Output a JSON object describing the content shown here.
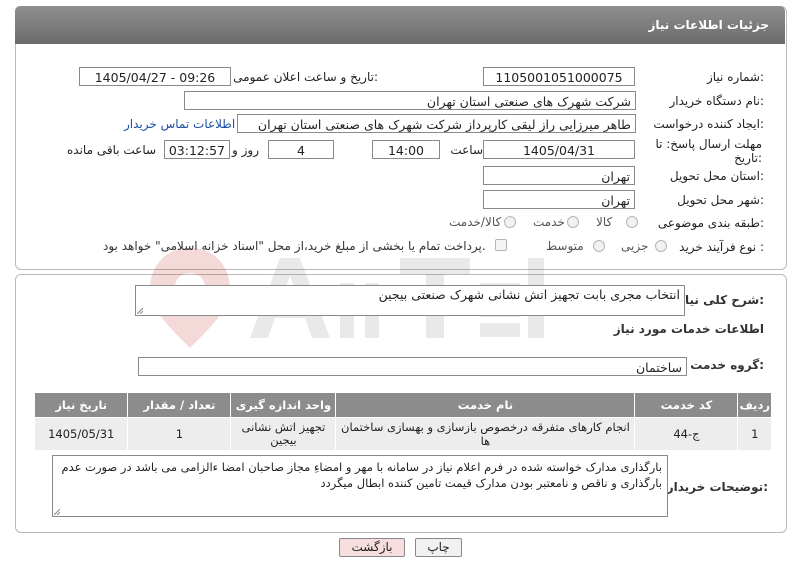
{
  "header": {
    "title": "جزئیات اطلاعات نیاز"
  },
  "fields": {
    "need_number_label": "شماره نیاز:",
    "need_number": "1105001051000075",
    "announce_label": "تاریخ و ساعت اعلان عمومی:",
    "announce_value": "1405/04/27 - 09:26",
    "buyer_org_label": "نام دستگاه خریدار:",
    "buyer_org": "شرکت شهرک های صنعتی استان تهران",
    "requester_label": "ایجاد کننده درخواست:",
    "requester": "طاهر  میرزایی راز لیقی کارپرداز شرکت شهرک های صنعتی استان تهران",
    "contact_link": "اطلاعات تماس خریدار",
    "deadline_label": "مهلت ارسال پاسخ: تا تاریخ:",
    "deadline_date": "1405/04/31",
    "time_label": "ساعت",
    "deadline_time": "14:00",
    "days_value": "4",
    "days_label": "روز و",
    "remaining_time": "03:12:57",
    "remaining_label": "ساعت باقی مانده",
    "province_label": "استان محل تحویل:",
    "province": "تهران",
    "city_label": "شهر محل تحویل:",
    "city": "تهران",
    "category_label": "طبقه بندی موضوعی:",
    "category_options": [
      "کالا",
      "خدمت",
      "کالا/خدمت"
    ],
    "process_label": "نوع فرآیند خرید :",
    "process_options": [
      "جزیی",
      "متوسط"
    ],
    "payment_note": "پرداخت تمام یا بخشی از مبلغ خرید،از محل \"اسناد خزانه اسلامی\" خواهد بود."
  },
  "summary": {
    "label": "شرح کلی نیاز:",
    "value": "انتخاب مجری بابت تجهیز اتش نشانی شهرک صنعتی بیجین"
  },
  "services": {
    "heading": "اطلاعات خدمات مورد نیاز",
    "group_label": "گروه خدمت:",
    "group_value": "ساختمان",
    "columns": [
      "ردیف",
      "کد خدمت",
      "نام خدمت",
      "واحد اندازه گیری",
      "تعداد / مقدار",
      "تاریخ نیاز"
    ],
    "rows": [
      [
        "1",
        "ج-44",
        "انجام کارهای متفرقه درخصوص بازسازی و بهسازی ساختمان ها",
        "تجهیز اتش نشانی بیجین",
        "1",
        "1405/05/31"
      ]
    ]
  },
  "buyer_notes": {
    "label": "توضیحات خریدار:",
    "text": "بارگذاری مدارک خواسته شده در فرم اعلام نیاز در سامانه با مهر و امضاءِ مجاز صاحبان امضا ءالزامی می باشد در صورت عدم بارگذاری و ناقص و نامعتبر بودن مدارک قیمت تامین کننده ابطال میگردد"
  },
  "buttons": {
    "print": "چاپ",
    "back": "بازگشت"
  },
  "colors": {
    "header_bg": "#7d7d7d",
    "table_header": "#8c8c8c",
    "back_button": "#f6dede",
    "link": "#1a4fa3"
  }
}
